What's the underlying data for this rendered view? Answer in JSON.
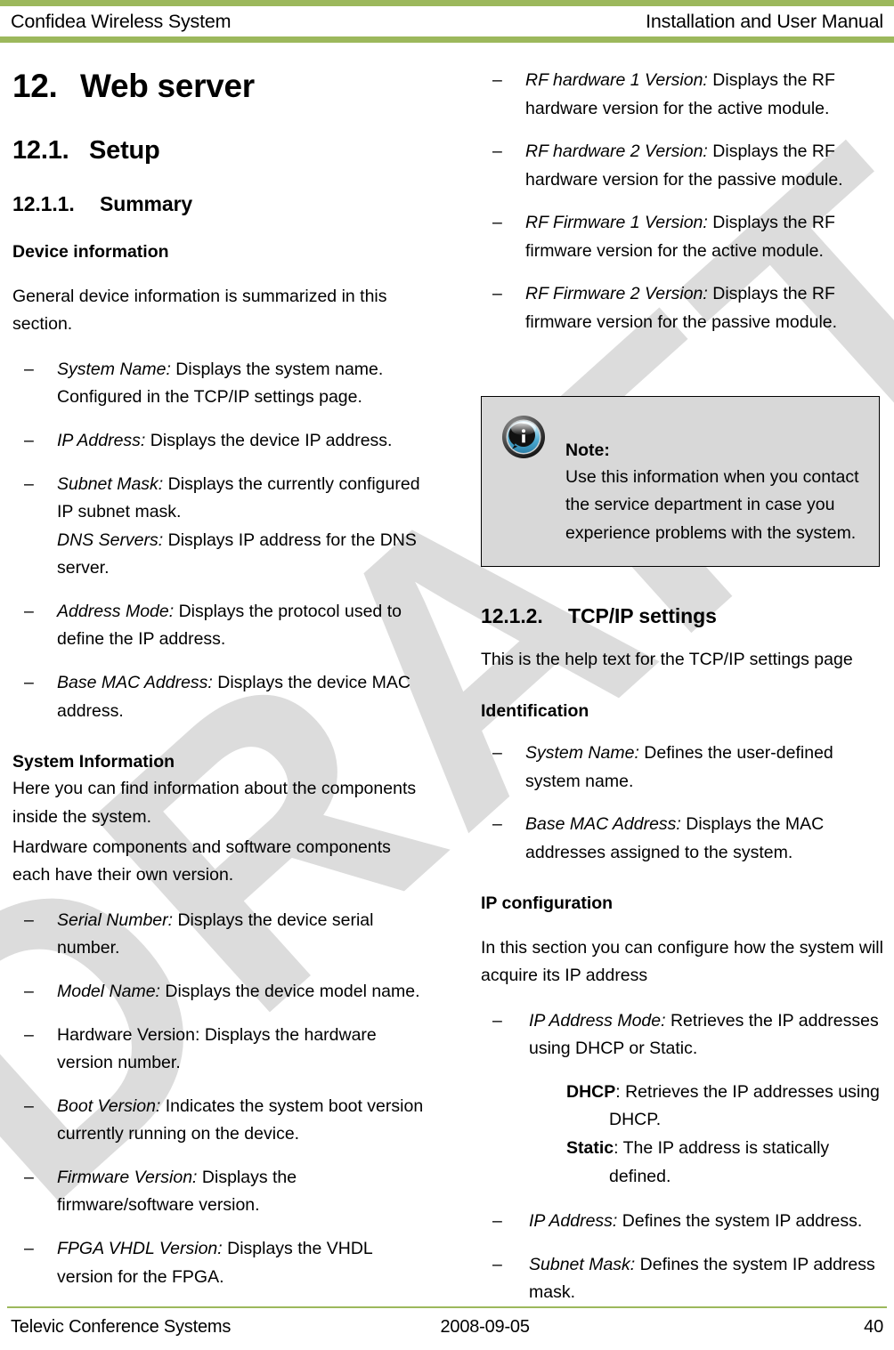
{
  "header": {
    "left": "Confidea Wireless System",
    "right": "Installation and User Manual"
  },
  "watermark": {
    "text": "DRAFT",
    "color": "#dcdcdc"
  },
  "theme": {
    "accent_green": "#9cb85c",
    "note_background": "#d8d8d8",
    "note_border": "#000000"
  },
  "left_column": {
    "chapter_heading": {
      "number": "12.",
      "title": "Web server"
    },
    "section_heading": {
      "number": "12.1.",
      "title": "Setup"
    },
    "subsection_heading": {
      "number": "12.1.1.",
      "title": "Summary"
    },
    "device_information_title": "Device information",
    "device_information_intro": "General device information is summarized in this section.",
    "device_information_items": [
      {
        "term": "System Name:",
        "term_style": "italic",
        "desc": " Displays the system name. Configured in the TCP/IP settings page."
      },
      {
        "term": "IP Address:",
        "term_style": "italic",
        "desc": " Displays the device IP address."
      },
      {
        "term": "Subnet Mask:",
        "term_style": "italic",
        "desc": " Displays the currently configured IP subnet mask.",
        "extra_term": "DNS Servers:",
        "extra_term_style": "italic",
        "extra_desc": " Displays IP address for the DNS server."
      },
      {
        "term": "Address Mode:",
        "term_style": "italic",
        "desc": " Displays the protocol used to define the IP address."
      },
      {
        "term": "Base MAC Address:",
        "term_style": "italic",
        "desc": " Displays the device MAC address."
      }
    ],
    "system_information_title": "System Information",
    "system_information_intro_1": "Here you can find information about the components inside the system.",
    "system_information_intro_2": "Hardware components and software components each have their own version.",
    "system_information_items": [
      {
        "term": "Serial Number:",
        "term_style": "italic",
        "desc": " Displays the device serial number."
      },
      {
        "term": "Model Name:",
        "term_style": "italic",
        "desc": " Displays the device model name."
      },
      {
        "term": "Hardware Version:",
        "term_style": "regular",
        "desc": " Displays the hardware version number."
      },
      {
        "term": "Boot Version:",
        "term_style": "italic",
        "desc": " Indicates the system boot version currently running on the device."
      },
      {
        "term": "Firmware Version:",
        "term_style": "italic",
        "desc": " Displays the firmware/software version."
      },
      {
        "term": "FPGA VHDL Version:",
        "term_style": "italic",
        "desc": " Displays the VHDL version for the FPGA."
      }
    ]
  },
  "right_column": {
    "rf_items": [
      {
        "term": "RF hardware 1 Version:",
        "term_style": "italic",
        "desc": " Displays the RF hardware version for the active module."
      },
      {
        "term": "RF hardware 2 Version:",
        "term_style": "italic",
        "desc": " Displays the RF hardware version for the passive module."
      },
      {
        "term": "RF Firmware 1 Version:",
        "term_style": "italic",
        "desc": " Displays the RF firmware version for the active module."
      },
      {
        "term": "RF Firmware 2 Version:",
        "term_style": "italic",
        "desc": " Displays the RF firmware version for the passive module."
      }
    ],
    "note": {
      "icon": "info-icon",
      "title": "Note:",
      "lines": [
        "Use this information when you contact",
        "the service department in case you",
        "experience problems with the system."
      ]
    },
    "tcpip_heading": {
      "number": "12.1.2.",
      "title": "TCP/IP settings"
    },
    "tcpip_intro": "This is the help text for the TCP/IP settings page",
    "identification_title": "Identification",
    "identification_items": [
      {
        "term": "System Name:",
        "term_style": "italic",
        "desc": " Defines the user-defined system name."
      },
      {
        "term": "Base MAC Address:",
        "term_style": "italic",
        "desc": " Displays the MAC addresses assigned to the system."
      }
    ],
    "ip_configuration_title": "IP configuration",
    "ip_configuration_intro": "In this section you can configure how the system will acquire its IP address",
    "ip_mode_item": {
      "term": "IP Address Mode:",
      "term_style": "italic",
      "desc": " Retrieves the IP addresses using DHCP or Static."
    },
    "ip_mode_options": [
      {
        "label": "DHCP",
        "desc": ": Retrieves the IP addresses using DHCP."
      },
      {
        "label": "Static",
        "desc": ": The IP address is statically defined."
      }
    ],
    "ip_items": [
      {
        "term": "IP Address:",
        "term_style": "italic",
        "desc": " Defines the system IP address."
      },
      {
        "term": "Subnet Mask:",
        "term_style": "italic",
        "desc": " Defines the system IP address mask."
      }
    ]
  },
  "footer": {
    "left": "Televic Conference Systems",
    "center": "2008-09-05",
    "right": "40"
  },
  "symbols": {
    "dash": "–"
  }
}
